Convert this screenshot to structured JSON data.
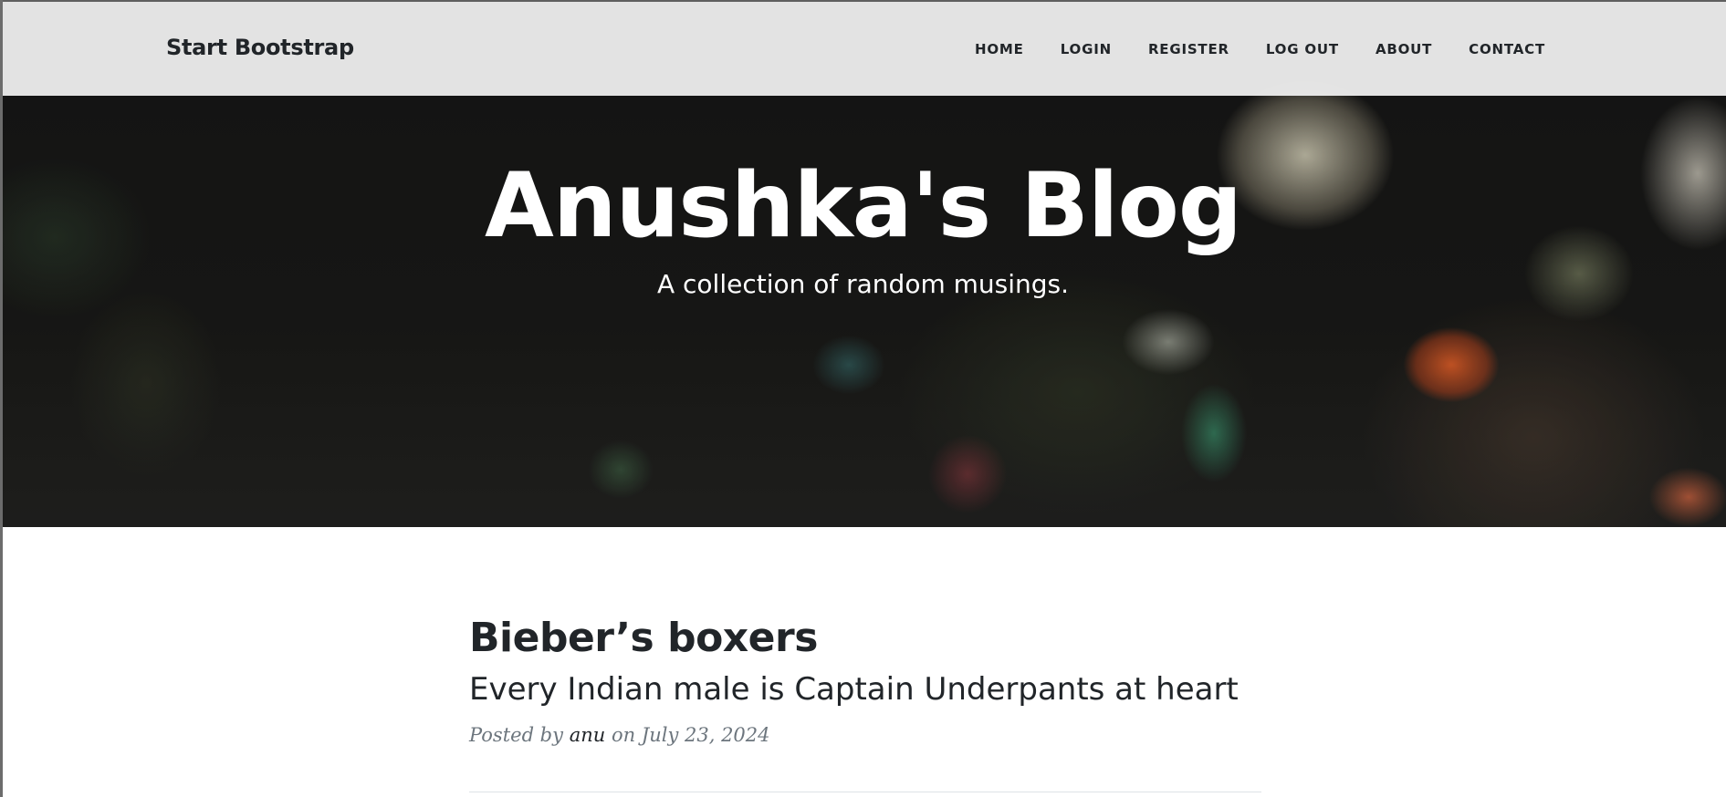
{
  "navbar": {
    "brand": "Start Bootstrap",
    "links": [
      "HOME",
      "LOGIN",
      "REGISTER",
      "LOG OUT",
      "ABOUT",
      "CONTACT"
    ]
  },
  "hero": {
    "title": "Anushka's Blog",
    "subtitle": "A collection of random musings."
  },
  "post": {
    "title": "Bieber’s boxers",
    "subtitle": "Every Indian male is Captain Underpants at heart",
    "meta_prefix": "Posted by",
    "author": "anu",
    "meta_date": "on July 23, 2024"
  },
  "colors": {
    "navbar_bg": "#ececec",
    "text_dark": "#212529",
    "meta_gray": "#6c757d",
    "hero_text": "#ffffff"
  }
}
